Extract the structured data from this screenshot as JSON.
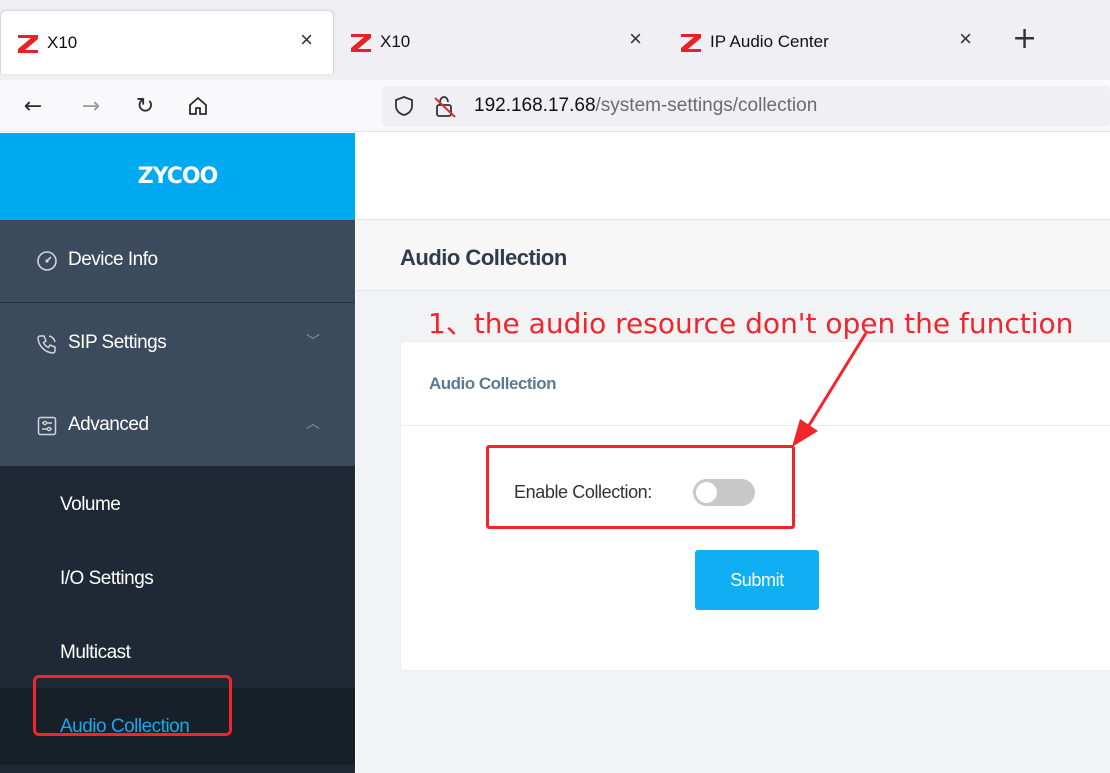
{
  "browser": {
    "tabs": [
      {
        "title": "X10",
        "active": true
      },
      {
        "title": "X10",
        "active": false
      },
      {
        "title": "IP Audio Center",
        "active": false
      }
    ],
    "close_glyph": "×",
    "new_tab_glyph": "+",
    "url_host": "192.168.17.68",
    "url_path": "/system-settings/collection",
    "icons": [
      "back-arrow-icon",
      "forward-arrow-icon",
      "reload-icon",
      "home-icon",
      "shield-icon",
      "insecure-lock-icon"
    ]
  },
  "sidebar": {
    "brand": "ZYCOO",
    "menu": [
      {
        "label": "Device Info",
        "icon": "gauge-icon"
      },
      {
        "label": "SIP Settings",
        "icon": "phone-icon",
        "expanded": false
      },
      {
        "label": "Advanced",
        "icon": "settings-panel-icon",
        "expanded": true
      }
    ],
    "submenu": [
      {
        "label": "Volume"
      },
      {
        "label": "I/O Settings"
      },
      {
        "label": "Multicast"
      },
      {
        "label": "Audio Collection",
        "active": true
      }
    ]
  },
  "main": {
    "page_title": "Audio Collection",
    "card_title": "Audio Collection",
    "enable_label": "Enable Collection:",
    "enable_value": false,
    "submit_label": "Submit"
  },
  "annotation": {
    "text": "1、the audio resource don't  open the function",
    "color": "#f0262b"
  },
  "colors": {
    "brand": "#00aaf0",
    "sidebar": "#243141",
    "button": "#10aef3",
    "active_link": "#1aa7ec"
  }
}
